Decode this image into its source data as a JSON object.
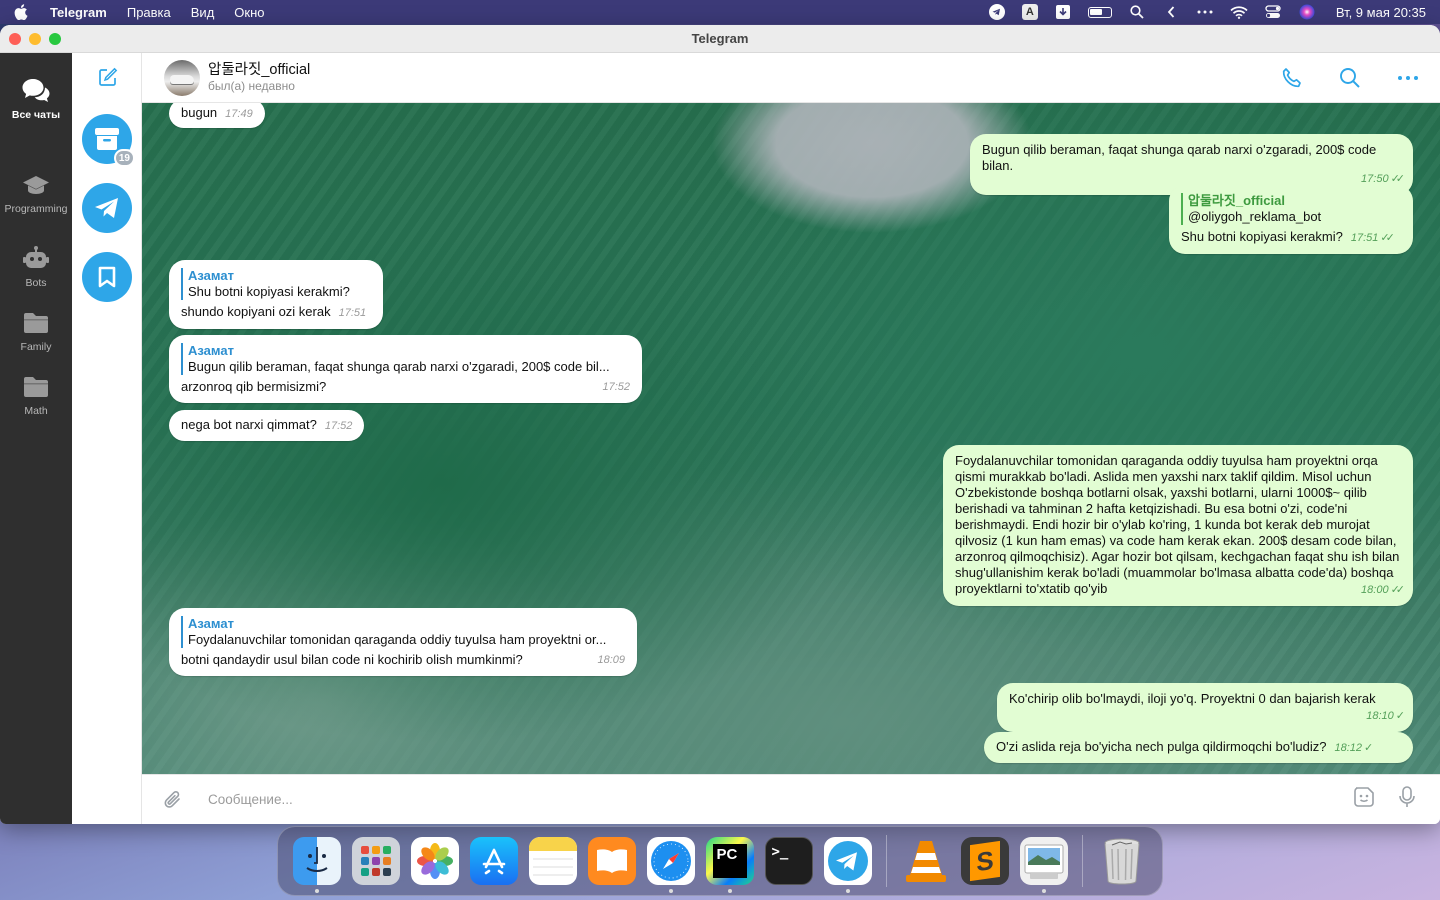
{
  "menubar": {
    "app": "Telegram",
    "menus": [
      "Правка",
      "Вид",
      "Окно"
    ],
    "input_source": "A",
    "datetime": "Вт, 9 мая  20:35"
  },
  "window": {
    "title": "Telegram"
  },
  "folders": [
    {
      "label": "Все чаты",
      "icon": "chats-icon",
      "active": true
    },
    {
      "label": "Programming",
      "icon": "graduation-cap-icon",
      "active": false
    },
    {
      "label": "Bots",
      "icon": "robot-icon",
      "active": false
    },
    {
      "label": "Family",
      "icon": "folder-icon",
      "active": false
    },
    {
      "label": "Math",
      "icon": "folder-icon",
      "active": false
    }
  ],
  "chatlist": {
    "archive_badge": "19"
  },
  "header": {
    "name": "압둘라짓_official",
    "status": "был(а) недавно"
  },
  "messages": [
    {
      "dir": "in",
      "text": "bugun",
      "time": "17:49"
    },
    {
      "dir": "out",
      "text": "Bugun qilib beraman, faqat shunga qarab narxi o'zgaradi, 200$ code bilan.",
      "time": "17:50"
    },
    {
      "dir": "out",
      "quote_name": "압둘라짓_official",
      "quote_text": "@oliygoh_reklama_bot",
      "text": "Shu botni kopiyasi kerakmi?",
      "time": "17:51"
    },
    {
      "dir": "in",
      "quote_name": "Азамат",
      "quote_text": "Shu botni kopiyasi kerakmi?",
      "text": "shundo kopiyani ozi kerak",
      "time": "17:51"
    },
    {
      "dir": "in",
      "quote_name": "Азамат",
      "quote_text": "Bugun qilib beraman, faqat shunga qarab narxi o'zgaradi, 200$ code bil...",
      "text": "arzonroq qib bermisizmi?",
      "time": "17:52"
    },
    {
      "dir": "in",
      "text": "nega bot narxi qimmat?",
      "time": "17:52"
    },
    {
      "dir": "out",
      "text": "Foydalanuvchilar tomonidan qaraganda oddiy tuyulsa ham proyektni orqa qismi murakkab bo'ladi. Aslida men yaxshi narx taklif qildim. Misol uchun O'zbekistonde boshqa botlarni olsak, yaxshi botlarni, ularni 1000$~ qilib berishadi va tahminan 2 hafta ketqizishadi. Bu esa botni o'zi, code'ni berishmaydi. Endi hozir bir o'ylab ko'ring, 1 kunda bot kerak deb murojat qilvosiz (1 kun ham emas) va code ham kerak ekan. 200$ desam code bilan, arzonroq qilmoqchisiz). Agar hozir bot qilsam, kechgachan faqat shu ish bilan shug'ullanishim kerak bo'ladi (muammolar bo'lmasa albatta code'da) boshqa proyektlarni to'xtatib qo'yib",
      "time": "18:00"
    },
    {
      "dir": "in",
      "quote_name": "Азамат",
      "quote_text": "Foydalanuvchilar tomonidan qaraganda oddiy tuyulsa ham proyektni or...",
      "text": "botni qandaydir usul bilan code ni kochirib olish mumkinmi?",
      "time": "18:09"
    },
    {
      "dir": "out",
      "text": "Ko'chirip olib bo'lmaydi, iloji yo'q. Proyektni 0 dan bajarish kerak",
      "time": "18:10"
    },
    {
      "dir": "out",
      "text": "O'zi aslida reja bo'yicha nech pulga qildirmoqchi bo'ludiz?",
      "time": "18:12"
    }
  ],
  "composer": {
    "placeholder": "Сообщение..."
  },
  "dock": {
    "apps": [
      "finder",
      "launchpad",
      "photos",
      "app-store",
      "notes",
      "books",
      "safari",
      "pycharm",
      "terminal",
      "telegram",
      "vlc",
      "sublime-text",
      "preview",
      "trash"
    ],
    "pycharm_label": "PC",
    "terminal_label": ">_",
    "sublime_label": "S"
  }
}
